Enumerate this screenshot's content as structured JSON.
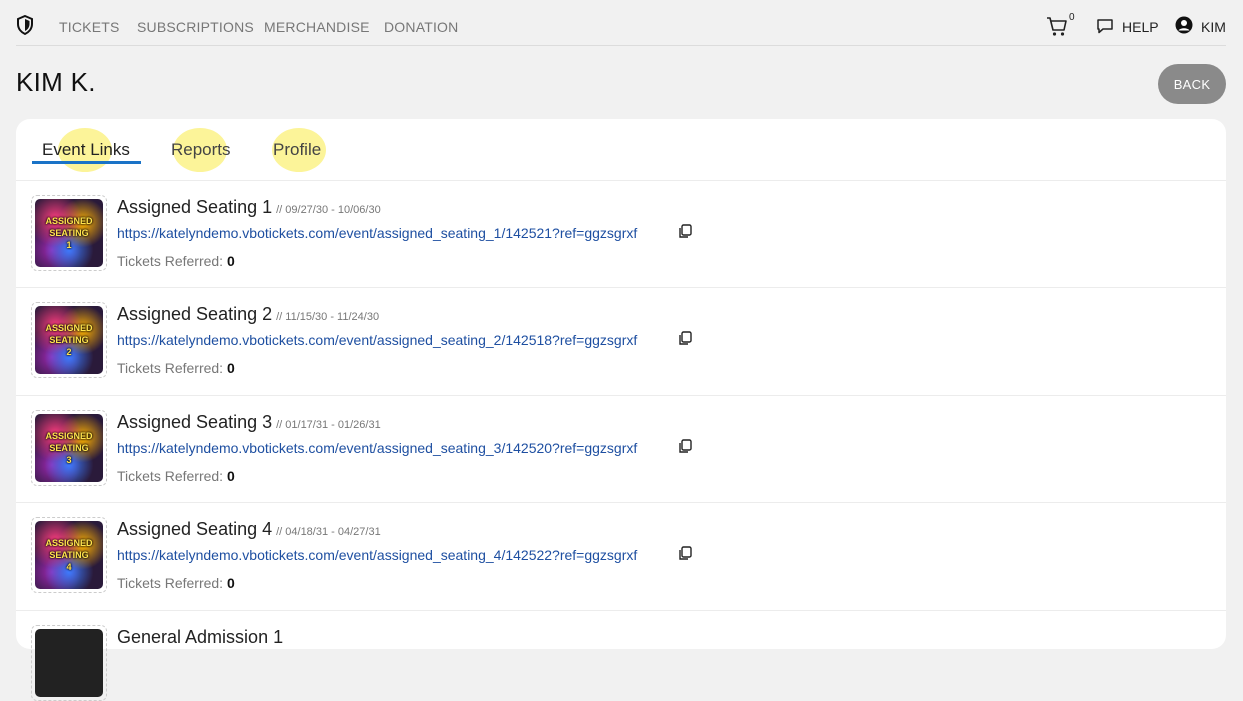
{
  "nav": {
    "logo_icon": "shield-icon",
    "links": [
      "TICKETS",
      "SUBSCRIPTIONS",
      "MERCHANDISE",
      "DONATION"
    ],
    "cart_count": "0",
    "help_label": "HELP",
    "user_label": "KIM"
  },
  "page": {
    "title": "KIM K.",
    "back_label": "BACK"
  },
  "tabs": [
    {
      "label": "Event Links",
      "active": true
    },
    {
      "label": "Reports",
      "active": false
    },
    {
      "label": "Profile",
      "active": false
    }
  ],
  "events": [
    {
      "title": "Assigned Seating 1",
      "dates": "// 09/27/30 - 10/06/30",
      "url": "https://katelyndemo.vbotickets.com/event/assigned_seating_1/142521?ref=ggzsgrxf",
      "ref_label": "Tickets Referred:",
      "ref_count": "0",
      "thumb": [
        "ASSIGNED",
        "SEATING",
        "1"
      ]
    },
    {
      "title": "Assigned Seating 2",
      "dates": "// 11/15/30 - 11/24/30",
      "url": "https://katelyndemo.vbotickets.com/event/assigned_seating_2/142518?ref=ggzsgrxf",
      "ref_label": "Tickets Referred:",
      "ref_count": "0",
      "thumb": [
        "ASSIGNED",
        "SEATING",
        "2"
      ]
    },
    {
      "title": "Assigned Seating 3",
      "dates": "// 01/17/31 - 01/26/31",
      "url": "https://katelyndemo.vbotickets.com/event/assigned_seating_3/142520?ref=ggzsgrxf",
      "ref_label": "Tickets Referred:",
      "ref_count": "0",
      "thumb": [
        "ASSIGNED",
        "SEATING",
        "3"
      ]
    },
    {
      "title": "Assigned Seating 4",
      "dates": "// 04/18/31 - 04/27/31",
      "url": "https://katelyndemo.vbotickets.com/event/assigned_seating_4/142522?ref=ggzsgrxf",
      "ref_label": "Tickets Referred:",
      "ref_count": "0",
      "thumb": [
        "ASSIGNED",
        "SEATING",
        "4"
      ]
    },
    {
      "title": "General Admission 1",
      "dates": "",
      "url": "",
      "ref_label": "",
      "ref_count": "",
      "thumb": [
        "",
        "",
        ""
      ]
    }
  ]
}
